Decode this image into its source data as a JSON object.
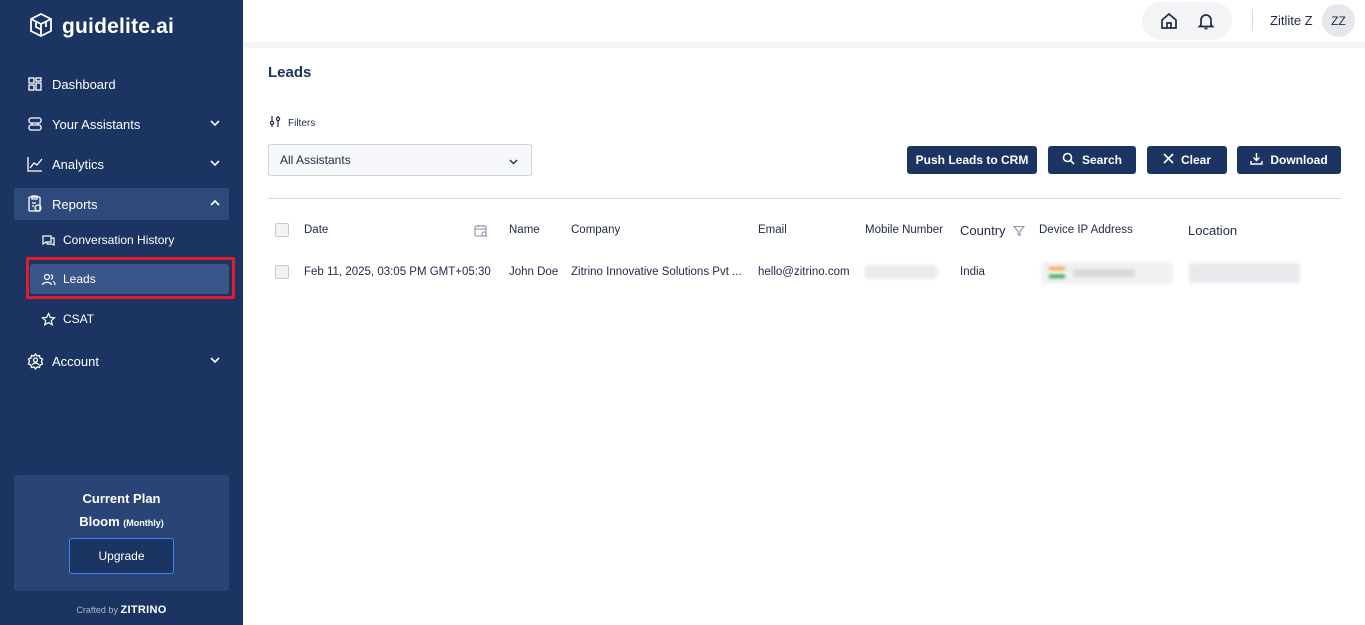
{
  "brand": {
    "name": "guidelite.ai"
  },
  "sidebar": {
    "nav": [
      {
        "label": "Dashboard"
      },
      {
        "label": "Your Assistants"
      },
      {
        "label": "Analytics"
      },
      {
        "label": "Reports"
      },
      {
        "label": "Account"
      }
    ],
    "reports_sub": [
      {
        "label": "Conversation History"
      },
      {
        "label": "Leads"
      },
      {
        "label": "CSAT"
      }
    ],
    "plan": {
      "title": "Current Plan",
      "name": "Bloom",
      "period": "(Monthly)",
      "upgrade_label": "Upgrade"
    },
    "crafted_prefix": "Crafted by",
    "crafted_brand": "ZITRINO"
  },
  "topbar": {
    "username": "Zitlite Z",
    "avatar_initials": "ZZ"
  },
  "main": {
    "title": "Leads",
    "filters_label": "Filters",
    "assistant_select": "All Assistants",
    "buttons": {
      "push": "Push Leads to CRM",
      "search": "Search",
      "clear": "Clear",
      "download": "Download"
    },
    "table": {
      "columns": [
        "Date",
        "Name",
        "Company",
        "Email",
        "Mobile Number",
        "Country",
        "Device IP Address",
        "Location"
      ],
      "rows": [
        {
          "date": "Feb 11, 2025, 03:05 PM GMT+05:30",
          "name": "John Doe",
          "company": "Zitrino Innovative Solutions Pvt ...",
          "email": "hello@zitrino.com",
          "country": "India"
        }
      ]
    }
  },
  "colors": {
    "sidebar_bg": "#1b3461",
    "accent": "#1b3461",
    "highlight": "#e11d2a"
  }
}
